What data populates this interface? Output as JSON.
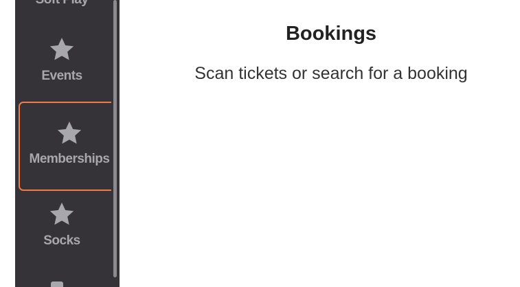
{
  "sidebar": {
    "items": [
      {
        "label": "Soft Play",
        "icon": "star-icon"
      },
      {
        "label": "Events",
        "icon": "star-icon"
      },
      {
        "label": "Memberships",
        "icon": "star-icon",
        "selected": true
      },
      {
        "label": "Socks",
        "icon": "star-icon"
      }
    ]
  },
  "main": {
    "title": "Bookings",
    "subtitle": "Scan tickets or search for a booking"
  },
  "colors": {
    "sidebar_bg": "#353337",
    "nav_text": "#a8a7ab",
    "highlight": "#f07c4a"
  }
}
